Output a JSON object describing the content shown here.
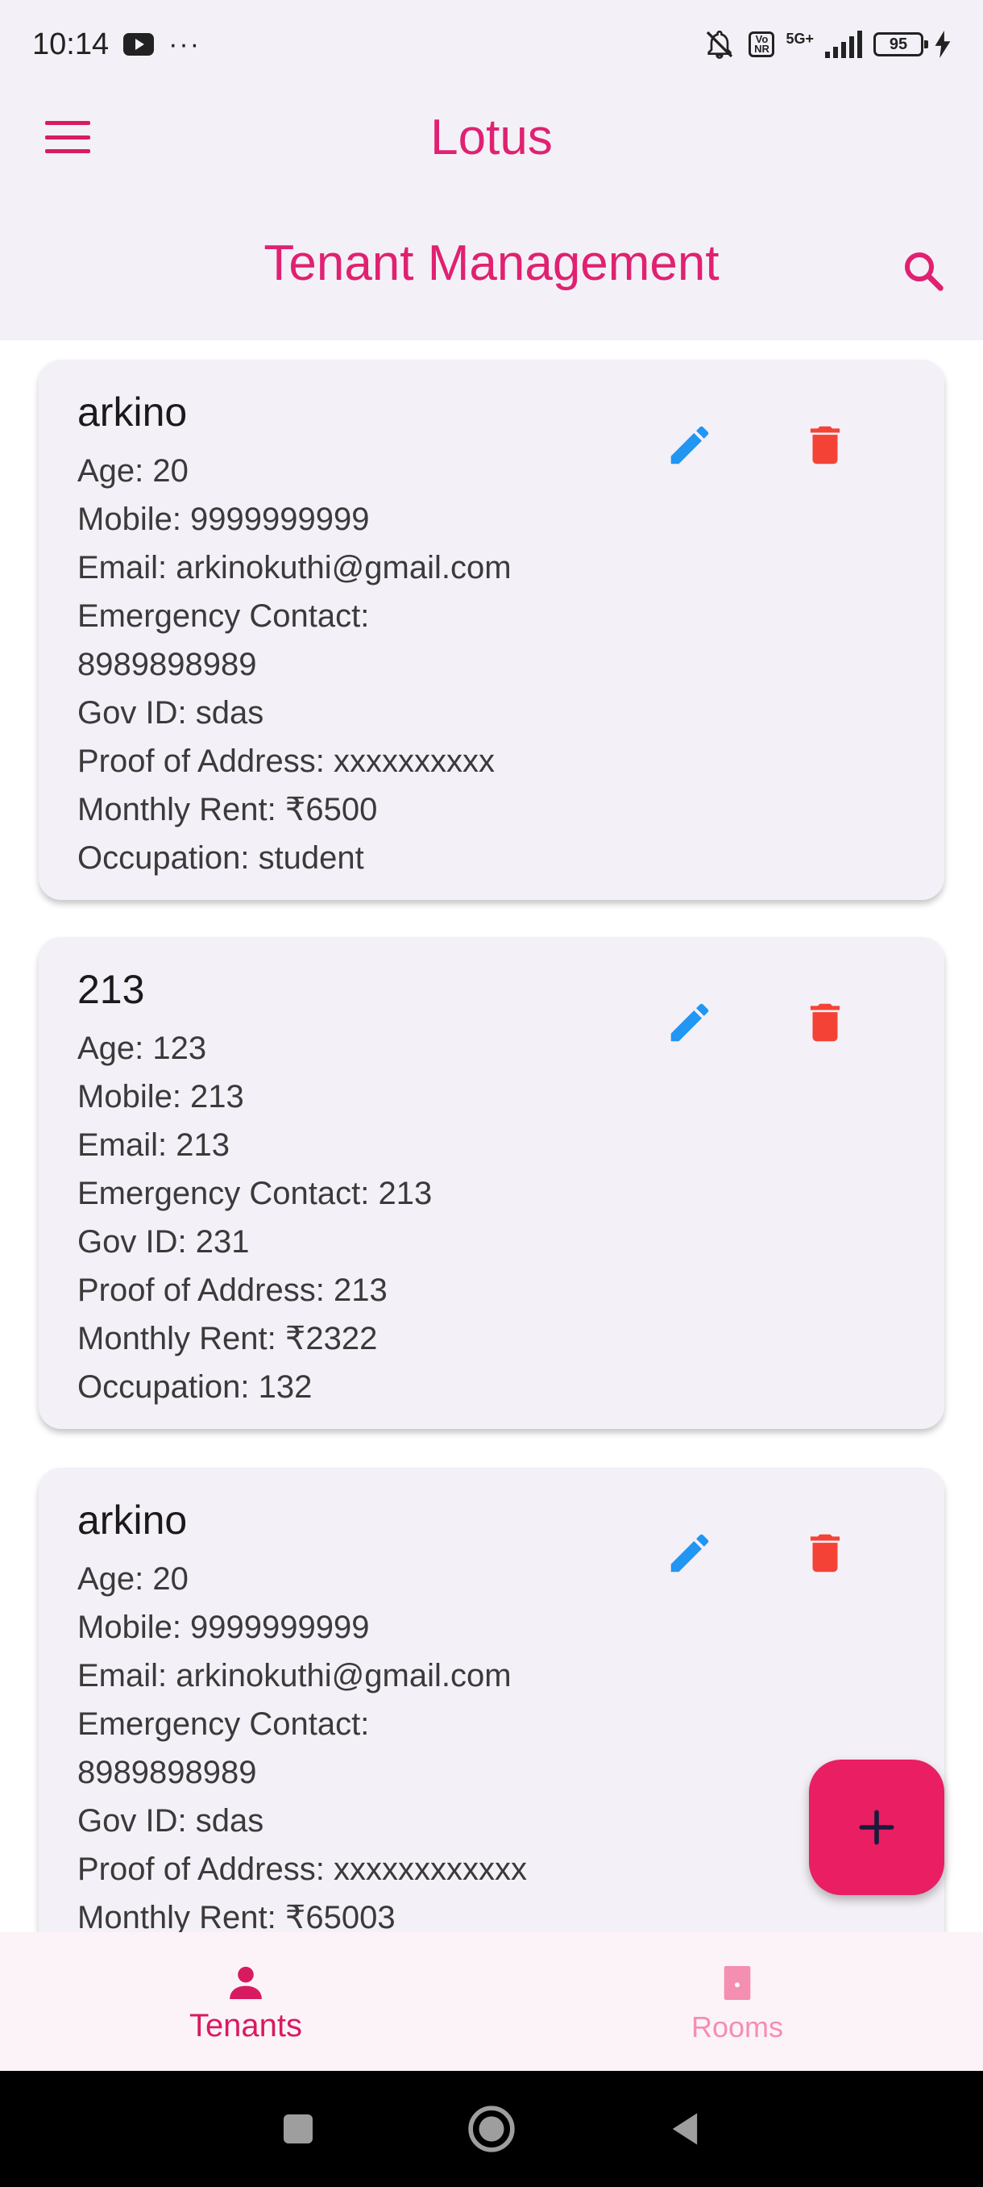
{
  "status_bar": {
    "time": "10:14",
    "overflow": "···",
    "battery": "95",
    "network": "5G+",
    "icons": [
      "youtube-icon",
      "mute-icon",
      "volte-icon",
      "signal-icon",
      "battery-icon",
      "charging-icon"
    ]
  },
  "app_bar": {
    "title": "Lotus",
    "menu_icon": "menu-icon"
  },
  "page": {
    "title": "Tenant Management",
    "search_icon": "search-icon"
  },
  "tenants": [
    {
      "name": "arkino",
      "lines": [
        "Age: 20",
        "Mobile: 9999999999",
        "Email: arkinokuthi@gmail.com",
        "Emergency Contact:",
        "8989898989",
        "Gov ID: sdas",
        "Proof of Address: xxxxxxxxxx",
        "Monthly Rent: ₹6500",
        "Occupation: student"
      ]
    },
    {
      "name": "213",
      "lines": [
        "Age: 123",
        "Mobile: 213",
        "Email: 213",
        "Emergency Contact: 213",
        "Gov ID: 231",
        "Proof of Address: 213",
        "Monthly Rent: ₹2322",
        "Occupation: 132"
      ]
    },
    {
      "name": "arkino",
      "lines": [
        "Age: 20",
        "Mobile: 9999999999",
        "Email: arkinokuthi@gmail.com",
        "Emergency Contact:",
        "8989898989",
        "Gov ID: sdas",
        "Proof of Address: xxxxxxxxxxxx",
        "Monthly Rent: ₹65003"
      ]
    }
  ],
  "fab": {
    "icon": "plus-icon"
  },
  "bottom_nav": {
    "items": [
      {
        "label": "Tenants",
        "icon": "person-icon",
        "active": true
      },
      {
        "label": "Rooms",
        "icon": "door-icon",
        "active": false
      }
    ]
  },
  "colors": {
    "accent": "#e02171",
    "edit": "#2196f3",
    "delete": "#f44336",
    "fab": "#e91e63"
  }
}
